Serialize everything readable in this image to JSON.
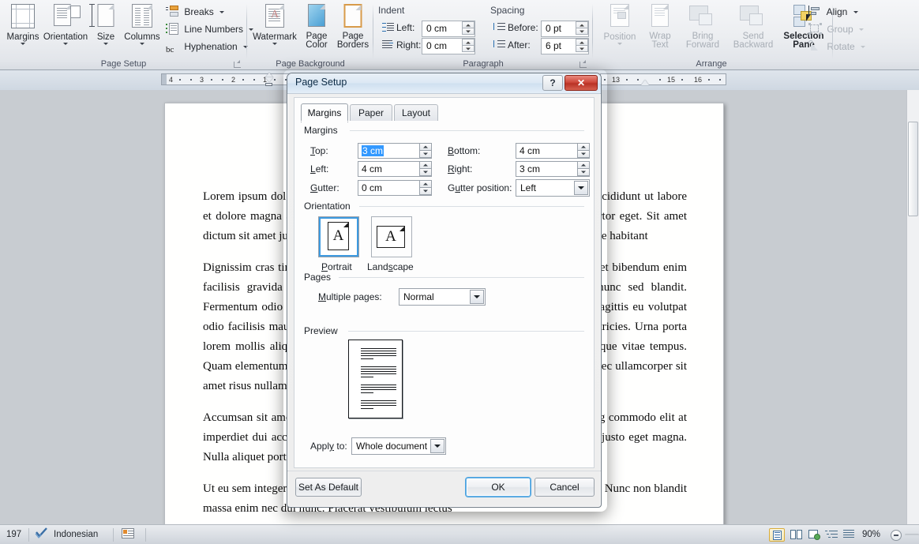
{
  "ribbon": {
    "groups": [
      {
        "name": "Page Setup",
        "label": "Page Setup"
      },
      {
        "name": "Page Background",
        "label": "Page Background"
      },
      {
        "name": "Paragraph",
        "label": "Paragraph"
      },
      {
        "name": "Arrange",
        "label": "Arrange"
      }
    ],
    "page_setup": {
      "margins": "Margins",
      "orientation": "Orientation",
      "size": "Size",
      "columns": "Columns",
      "breaks": "Breaks",
      "line_numbers": "Line Numbers",
      "hyphenation": "Hyphenation"
    },
    "page_background": {
      "watermark": "Watermark",
      "page_color_line1": "Page",
      "page_color_line2": "Color",
      "page_borders_line1": "Page",
      "page_borders_line2": "Borders"
    },
    "paragraph": {
      "indent_caption": "Indent",
      "spacing_caption": "Spacing",
      "left_label": "Left:",
      "left_value": "0 cm",
      "right_label": "Right:",
      "right_value": "0 cm",
      "before_label": "Before:",
      "before_value": "0 pt",
      "after_label": "After:",
      "after_value": "6 pt"
    },
    "arrange": {
      "position": "Position",
      "wrap_text_line1": "Wrap",
      "wrap_text_line2": "Text",
      "bring_forward_line1": "Bring",
      "bring_forward_line2": "Forward",
      "send_backward_line1": "Send",
      "send_backward_line2": "Backward",
      "selection_pane_line1": "Selection",
      "selection_pane_line2": "Pane",
      "align": "Align",
      "group": "Group",
      "rotate": "Rotate"
    }
  },
  "ruler": {
    "left_ticks": [
      "4",
      "3",
      "2",
      "1"
    ],
    "right_ticks": [
      "13",
      "15",
      "16"
    ]
  },
  "document": {
    "paragraphs": [
      "Lorem ipsum dolor sit amet, consectetur adipiscing elit, sed do eiusmod tempor incididunt ut labore et dolore magna aliqua. Eu volutpat odio facilisis mauris sit amet massa vitae tortor eget. Sit amet dictum sit amet justo donec enim diam. Amet consectetur adipiscing elit pellentesque habitant",
      "Dignissim cras tincidunt lobortis feugiat vivamus at augue. Elementum nunc aliquet bibendum enim facilisis gravida neque convallis a. Quis viverra nibh cras pulvinar mattis nunc sed blandit. Fermentum odio eu feugiat pretium nibh ipsum consequat nisl vel. Viverra orci sagittis eu volutpat odio facilisis mauris. Vulputate ut pharetra sit amet aliquam id diam maecenas ultricies. Urna porta lorem mollis aliquam ut porttitor leo a diam. Convallis a cras semper auctor neque vitae tempus. Quam elementum pulvinar etiam non quam lacus suspendisse faucibus interdum. Nec ullamcorper sit amet risus nullam eget felis eget nunc.",
      "Accumsan sit amet nulla facilisi morbi tempus iaculis urna. Pellentesque adipiscing commodo elit at imperdiet dui accumsan sit amet nulla. Dignissim sodales ut eu sem integer vitae justo eget magna. Nulla aliquet porttitor lacus luctus accumsan tortor posuere ac ut consequat",
      "Ut eu sem integer vitae justo. Scelerisque eu ultrices vitae auctor eu augue ut lectus. Nunc non blandit massa enim nec dui nunc. Placerat vestibulum lectus"
    ]
  },
  "status_bar": {
    "page_count": "197",
    "language": "Indonesian",
    "zoom": "90%"
  },
  "dialog": {
    "title": "Page Setup",
    "help_label": "?",
    "close_label": "✕",
    "tabs": [
      {
        "label": "Margins",
        "active": true
      },
      {
        "label": "Paper",
        "active": false
      },
      {
        "label": "Layout",
        "active": false
      }
    ],
    "margins": {
      "section_label": "Margins",
      "top_label": "Top:",
      "top_value": "3 cm",
      "bottom_label": "Bottom:",
      "bottom_value": "4 cm",
      "left_label": "Left:",
      "left_value": "4 cm",
      "right_label": "Right:",
      "right_value": "3 cm",
      "gutter_label": "Gutter:",
      "gutter_value": "0 cm",
      "gutter_position_label": "Gutter position:",
      "gutter_position_value": "Left"
    },
    "orientation": {
      "section_label": "Orientation",
      "portrait_label": "Portrait",
      "landscape_label": "Landscape",
      "glyph": "A",
      "selected": "Portrait"
    },
    "pages": {
      "section_label": "Pages",
      "multiple_pages_label": "Multiple pages:",
      "multiple_pages_value": "Normal"
    },
    "preview": {
      "section_label": "Preview",
      "apply_to_label": "Apply to:",
      "apply_to_value": "Whole document"
    },
    "buttons": {
      "set_as_default": "Set As Default",
      "ok": "OK",
      "cancel": "Cancel"
    }
  },
  "colors": {
    "accent": "#3d9ae0",
    "selection": "#3399ff",
    "close_red": "#cf4a3c",
    "ribbon_bg": "#eceef1",
    "doc_bg": "#c8ccd1"
  }
}
